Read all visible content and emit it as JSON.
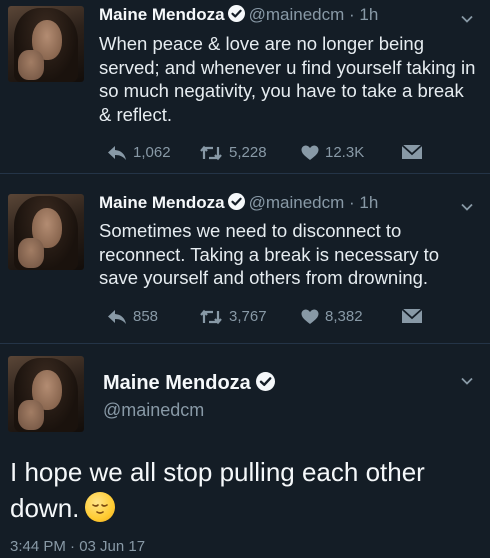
{
  "tweets": [
    {
      "name": "Maine Mendoza",
      "handle": "@mainedcm",
      "time": "1h",
      "text": "When peace & love are no longer being served; and whenever u find yourself taking in so much negativity, you have to take a break & reflect.",
      "replies": "1,062",
      "retweets": "5,228",
      "likes": "12.3K"
    },
    {
      "name": "Maine Mendoza",
      "handle": "@mainedcm",
      "time": "1h",
      "text": "Sometimes we need to disconnect to reconnect. Taking a break is necessary to save yourself and others from drowning.",
      "replies": "858",
      "retweets": "3,767",
      "likes": "8,382"
    }
  ],
  "main_tweet": {
    "name": "Maine Mendoza",
    "handle": "@mainedcm",
    "text": "I hope we all stop pulling each other down.",
    "emoji": "sleepy-face-emoji",
    "timestamp": "3:44 PM · 03 Jun 17"
  },
  "icons": {
    "verified": "verified-badge-icon",
    "chevron": "chevron-down-icon",
    "reply": "reply-icon",
    "retweet": "retweet-icon",
    "like": "heart-icon",
    "dm": "envelope-icon"
  },
  "colors": {
    "background": "#141d26",
    "verified": "#f5f8fa",
    "muted": "#8899a6",
    "text": "#e6ecf0"
  }
}
